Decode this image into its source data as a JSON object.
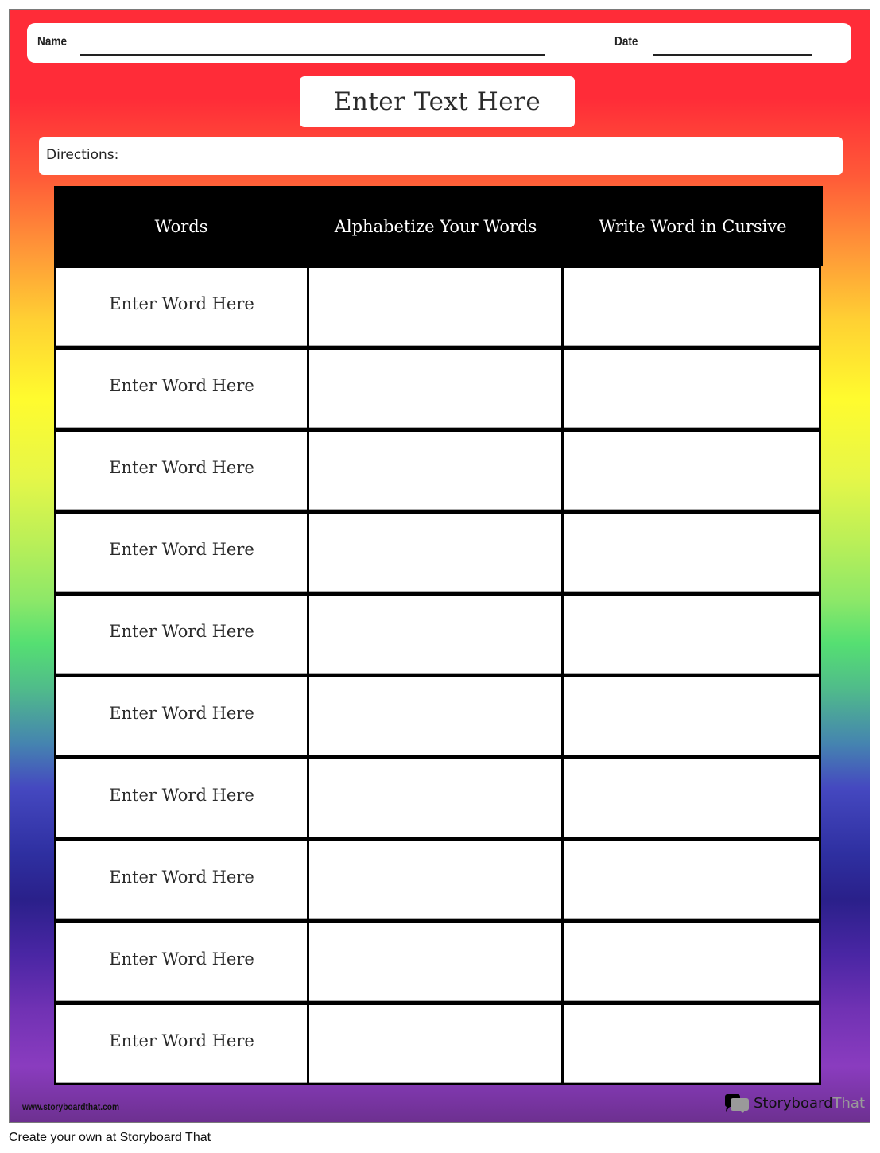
{
  "worksheet": {
    "name_label": "Name",
    "date_label": "Date",
    "title": "Enter Text Here",
    "directions_label": "Directions:",
    "background_gradient": [
      "#ff2c38",
      "#ff9a38",
      "#fffb2e",
      "#55df72",
      "#4548c0",
      "#2a208a",
      "#8a3cbf"
    ]
  },
  "table": {
    "headers": [
      "Words",
      "Alphabetize Your Words",
      "Write Word in Cursive"
    ],
    "rows": [
      {
        "word": "Enter Word Here",
        "alphabetized": "",
        "cursive": ""
      },
      {
        "word": "Enter Word Here",
        "alphabetized": "",
        "cursive": ""
      },
      {
        "word": "Enter Word Here",
        "alphabetized": "",
        "cursive": ""
      },
      {
        "word": "Enter Word Here",
        "alphabetized": "",
        "cursive": ""
      },
      {
        "word": "Enter Word Here",
        "alphabetized": "",
        "cursive": ""
      },
      {
        "word": "Enter Word Here",
        "alphabetized": "",
        "cursive": ""
      },
      {
        "word": "Enter Word Here",
        "alphabetized": "",
        "cursive": ""
      },
      {
        "word": "Enter Word Here",
        "alphabetized": "",
        "cursive": ""
      },
      {
        "word": "Enter Word Here",
        "alphabetized": "",
        "cursive": ""
      },
      {
        "word": "Enter Word Here",
        "alphabetized": "",
        "cursive": ""
      }
    ]
  },
  "footer": {
    "url": "www.storyboardthat.com",
    "brand_primary": "Storyboard",
    "brand_secondary": "That",
    "brand_icon": "speech-bubbles-icon",
    "caption": "Create your own at Storyboard That"
  }
}
